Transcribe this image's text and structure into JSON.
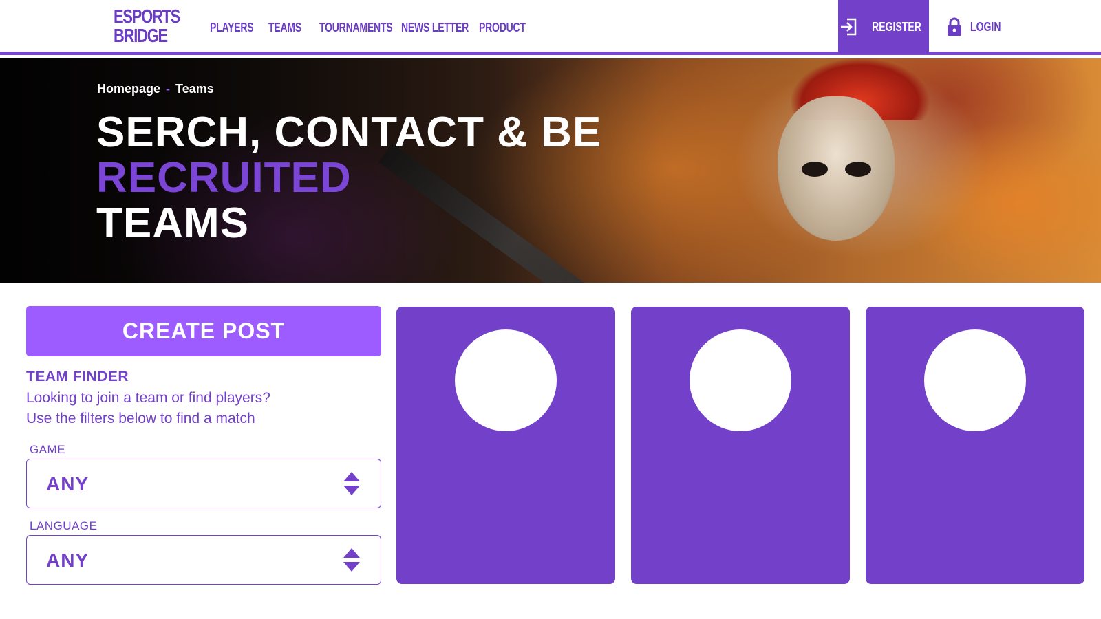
{
  "brand": {
    "logo_line1": "ESPORTS",
    "logo_line2": "BRIDGE"
  },
  "nav": {
    "links": [
      "PLAYERS",
      "TEAMS",
      "TOURNAMENTS",
      "NEWS LETTER",
      "PRODUCT"
    ],
    "register_label": "REGISTER",
    "login_label": "LOGIN"
  },
  "hero": {
    "breadcrumb": {
      "home": "Homepage",
      "separator": "-",
      "current": "Teams"
    },
    "title_line1": "SERCH, CONTACT & BE",
    "title_line2": "RECRUITED",
    "title_line3": "TEAMS"
  },
  "sidebar": {
    "create_post_label": "CREATE POST",
    "finder_title": "TEAM FINDER",
    "finder_desc_line1": "Looking to join a team or find players?",
    "finder_desc_line2": "Use the filters below to find a match",
    "filters": [
      {
        "label": "GAME",
        "value": "ANY"
      },
      {
        "label": "LANGUAGE",
        "value": "ANY"
      }
    ]
  },
  "cards": [
    {
      "avatar": "avatar-placeholder"
    },
    {
      "avatar": "avatar-placeholder"
    },
    {
      "avatar": "avatar-placeholder"
    }
  ],
  "colors": {
    "brand_purple": "#7341c9",
    "accent_purple": "#9d5cff",
    "white": "#ffffff"
  }
}
